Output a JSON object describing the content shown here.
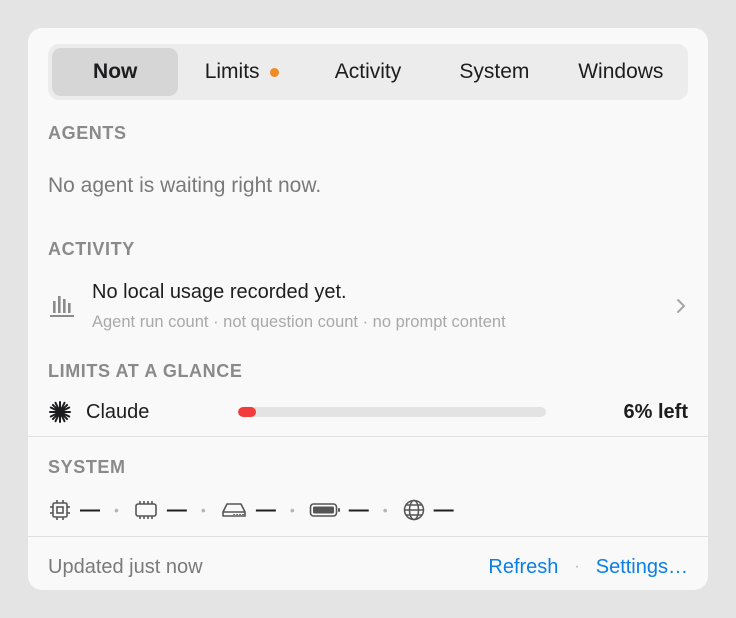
{
  "tabs": [
    {
      "label": "Now",
      "active": true
    },
    {
      "label": "Limits",
      "has_dot": true
    },
    {
      "label": "Activity"
    },
    {
      "label": "System"
    },
    {
      "label": "Windows"
    }
  ],
  "colors": {
    "dot": "#f08a24",
    "limit_fill": "#f23b3b",
    "link": "#0a7fe6"
  },
  "agents": {
    "title": "AGENTS",
    "empty_text": "No agent is waiting right now."
  },
  "activity": {
    "title": "ACTIVITY",
    "icon": "bar-chart-icon",
    "primary": "No local usage recorded yet.",
    "secondary": "Agent run count · not question count · no prompt content",
    "chevron_icon": "chevron-right-icon"
  },
  "limits": {
    "title": "LIMITS AT A GLANCE",
    "items": [
      {
        "icon": "claude-starburst-icon",
        "name": "Claude",
        "remaining_percent": 6,
        "left_text": "6% left"
      }
    ]
  },
  "system": {
    "title": "SYSTEM",
    "items": [
      {
        "icon": "cpu-chip-icon",
        "value": "—"
      },
      {
        "icon": "memory-icon",
        "value": "—"
      },
      {
        "icon": "disk-icon",
        "value": "—"
      },
      {
        "icon": "battery-icon",
        "value": "—"
      },
      {
        "icon": "network-globe-icon",
        "value": "—"
      }
    ]
  },
  "footer": {
    "updated": "Updated just now",
    "refresh": "Refresh",
    "settings": "Settings…"
  }
}
